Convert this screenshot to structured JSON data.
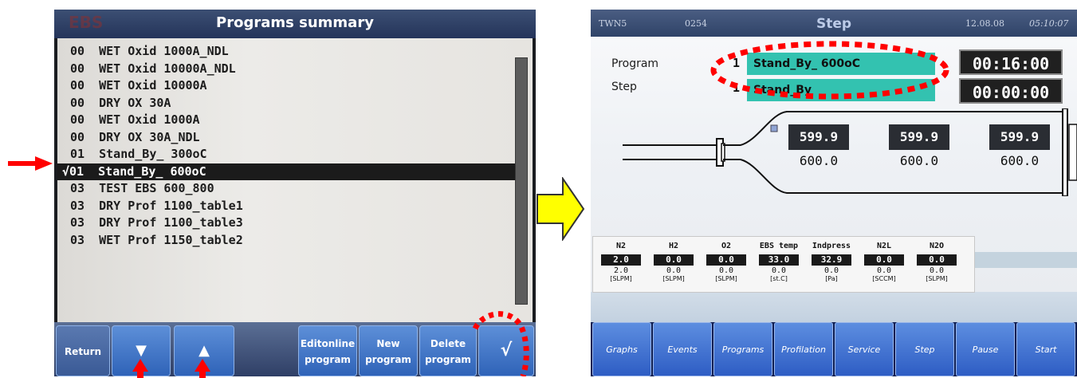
{
  "left": {
    "title": "Programs summary",
    "logo_text": "EBS",
    "programs": [
      {
        "text": "00  WET Oxid 1000A_NDL",
        "selected": false
      },
      {
        "text": "00  WET Oxid 10000A_NDL",
        "selected": false
      },
      {
        "text": "00  WET Oxid 10000A",
        "selected": false
      },
      {
        "text": "00  DRY OX 30A",
        "selected": false
      },
      {
        "text": "00  WET Oxid 1000A",
        "selected": false
      },
      {
        "text": "00  DRY OX 30A_NDL",
        "selected": false
      },
      {
        "text": "01  Stand_By_ 300oC",
        "selected": false
      },
      {
        "text": "√01  Stand_By_ 600oC",
        "selected": true
      },
      {
        "text": "03  TEST EBS 600_800",
        "selected": false
      },
      {
        "text": "03  DRY Prof 1100_table1",
        "selected": false
      },
      {
        "text": "03  DRY Prof 1100_table3",
        "selected": false
      },
      {
        "text": "03  WET Prof 1150_table2",
        "selected": false
      }
    ],
    "buttons": {
      "return": "Return",
      "down": "▼",
      "up": "▲",
      "editonline": [
        "Editonline",
        "program"
      ],
      "new": [
        "New",
        "program"
      ],
      "delete": [
        "Delete",
        "program"
      ],
      "confirm": "√"
    }
  },
  "right": {
    "header": {
      "system": "TWN5",
      "code": "0254",
      "title": "Step",
      "date": "12.08.08",
      "time": "05:10:07"
    },
    "program_label": "Program",
    "step_label": "Step",
    "program_num": "1",
    "step_num": "1",
    "program_name": "Stand_By_ 600oC",
    "step_name": "Stand_By",
    "program_time": "00:16:00",
    "step_time": "00:00:00",
    "zones": [
      {
        "actual": "599.9",
        "setpoint": "600.0"
      },
      {
        "actual": "599.9",
        "setpoint": "600.0"
      },
      {
        "actual": "599.9",
        "setpoint": "600.0"
      }
    ],
    "gases": [
      {
        "name": "N2",
        "actual": "2.0",
        "set": "2.0",
        "unit": "[SLPM]"
      },
      {
        "name": "H2",
        "actual": "0.0",
        "set": "0.0",
        "unit": "[SLPM]"
      },
      {
        "name": "O2",
        "actual": "0.0",
        "set": "0.0",
        "unit": "[SLPM]"
      },
      {
        "name": "EBS temp",
        "actual": "33.0",
        "set": "0.0",
        "unit": "[st.C]"
      },
      {
        "name": "Indpress",
        "actual": "32.9",
        "set": "0.0",
        "unit": "[Pa]"
      },
      {
        "name": "N2L",
        "actual": "0.0",
        "set": "0.0",
        "unit": "[SCCM]"
      },
      {
        "name": "N2O",
        "actual": "0.0",
        "set": "0.0",
        "unit": "[SLPM]"
      }
    ],
    "buttons": [
      "Graphs",
      "Events",
      "Programs",
      "Profilation",
      "Service",
      "Step",
      "Pause",
      "Start"
    ]
  },
  "colors": {
    "annotation_red": "#ff0000",
    "arrow_yellow": "#ffff00",
    "field_teal": "#33c2b0"
  }
}
